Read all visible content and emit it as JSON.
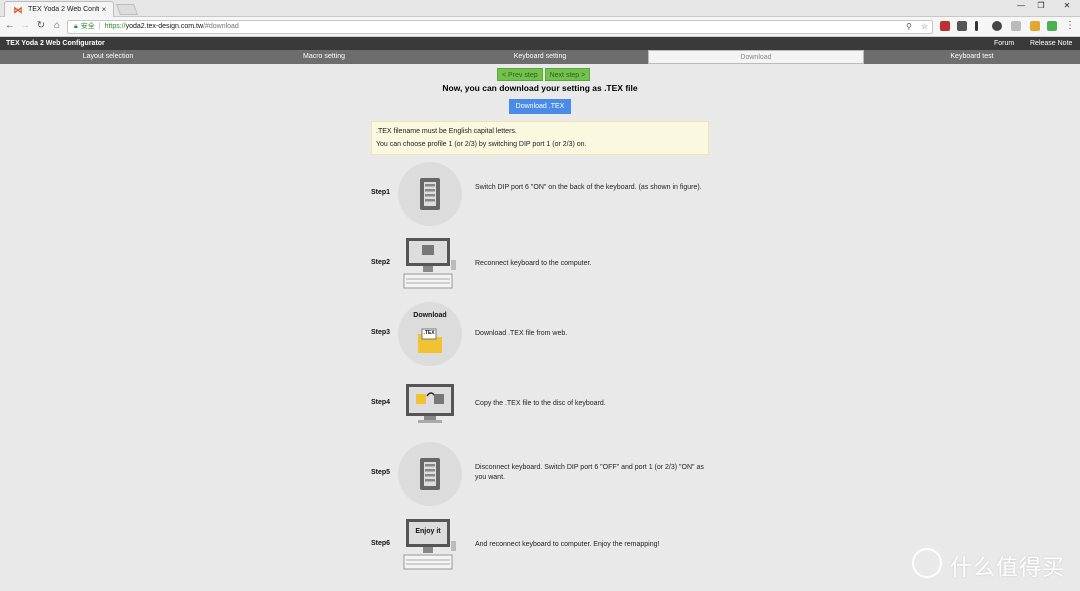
{
  "browser": {
    "tab_title": "TEX Yoda 2 Web Configu",
    "tab_close": "×",
    "security_label": "安全",
    "url_scheme": "https://",
    "url_host": "yoda2.tex-design.com.tw",
    "url_path": "/#download",
    "window_controls": [
      "—",
      "❐",
      "✕"
    ]
  },
  "app": {
    "title": "TEX Yoda 2 Web Configurator",
    "header_links": [
      "Forum",
      "Release Note"
    ],
    "nav": [
      {
        "label": "Layout selection",
        "active": false
      },
      {
        "label": "Macro setting",
        "active": false
      },
      {
        "label": "Keyboard setting",
        "active": false
      },
      {
        "label": "Download",
        "active": true
      },
      {
        "label": "Keyboard test",
        "active": false
      }
    ]
  },
  "main": {
    "prev_step": "< Prev step",
    "next_step": "Next step >",
    "headline": "Now, you can download your setting as .TEX file",
    "download_button": "Download .TEX",
    "notes": [
      ".TEX filename must be English capital letters.",
      "You can choose profile 1 (or 2/3) by switching DIP port 1 (or 2/3) on."
    ],
    "steps": [
      {
        "label": "Step1",
        "text": "Switch DIP port 6 \"ON\" on the back of the keyboard. (as shown in figure).",
        "art": "dip-switch"
      },
      {
        "label": "Step2",
        "text": "Reconnect keyboard to the computer.",
        "art": "computer"
      },
      {
        "label": "Step3",
        "text": "Download .TEX file from web.",
        "art": "download-folder",
        "art_title": "Download",
        "art_file": ".TEX"
      },
      {
        "label": "Step4",
        "text": "Copy the .TEX file to the disc of keyboard.",
        "art": "copy-monitor"
      },
      {
        "label": "Step5",
        "text": "Disconnect keyboard. Switch DIP port 6 \"OFF\" and port 1 (or 2/3) \"ON\" as you want.",
        "art": "dip-switch"
      },
      {
        "label": "Step6",
        "text": "And reconnect keyboard to computer. Enjoy the remapping!",
        "art": "computer-enjoy",
        "art_title": "Enjoy it"
      }
    ]
  },
  "watermark": {
    "text": "什么值得买"
  }
}
